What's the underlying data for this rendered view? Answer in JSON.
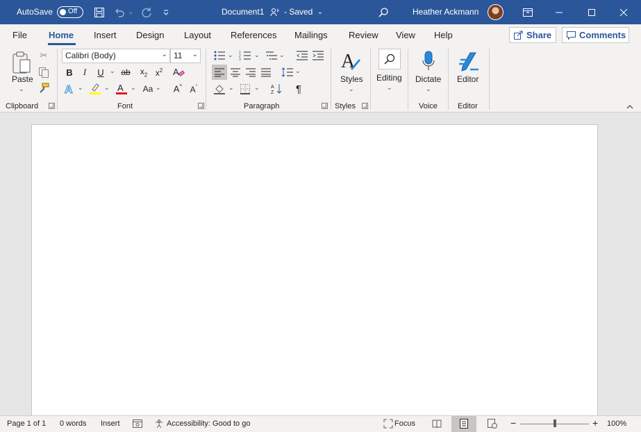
{
  "titlebar": {
    "autosave_label": "AutoSave",
    "autosave_state": "Off",
    "doc_title": "Document1",
    "saved_status": "- Saved",
    "user_name": "Heather Ackmann",
    "accent_color": "#2b579a"
  },
  "tabs": [
    {
      "label": "File"
    },
    {
      "label": "Home"
    },
    {
      "label": "Insert"
    },
    {
      "label": "Design"
    },
    {
      "label": "Layout"
    },
    {
      "label": "References"
    },
    {
      "label": "Mailings"
    },
    {
      "label": "Review"
    },
    {
      "label": "View"
    },
    {
      "label": "Help"
    }
  ],
  "actions": {
    "share": "Share",
    "comments": "Comments"
  },
  "ribbon": {
    "clipboard": {
      "paste": "Paste",
      "label": "Clipboard"
    },
    "font": {
      "family": "Calibri (Body)",
      "size": "11",
      "label": "Font"
    },
    "paragraph": {
      "label": "Paragraph"
    },
    "styles": {
      "button": "Styles",
      "label": "Styles"
    },
    "editing": {
      "button": "Editing"
    },
    "voice": {
      "button": "Dictate",
      "label": "Voice"
    },
    "editor": {
      "button": "Editor",
      "label": "Editor"
    }
  },
  "statusbar": {
    "page": "Page 1 of 1",
    "words": "0 words",
    "mode": "Insert",
    "accessibility": "Accessibility: Good to go",
    "focus": "Focus",
    "zoom": "100%"
  }
}
